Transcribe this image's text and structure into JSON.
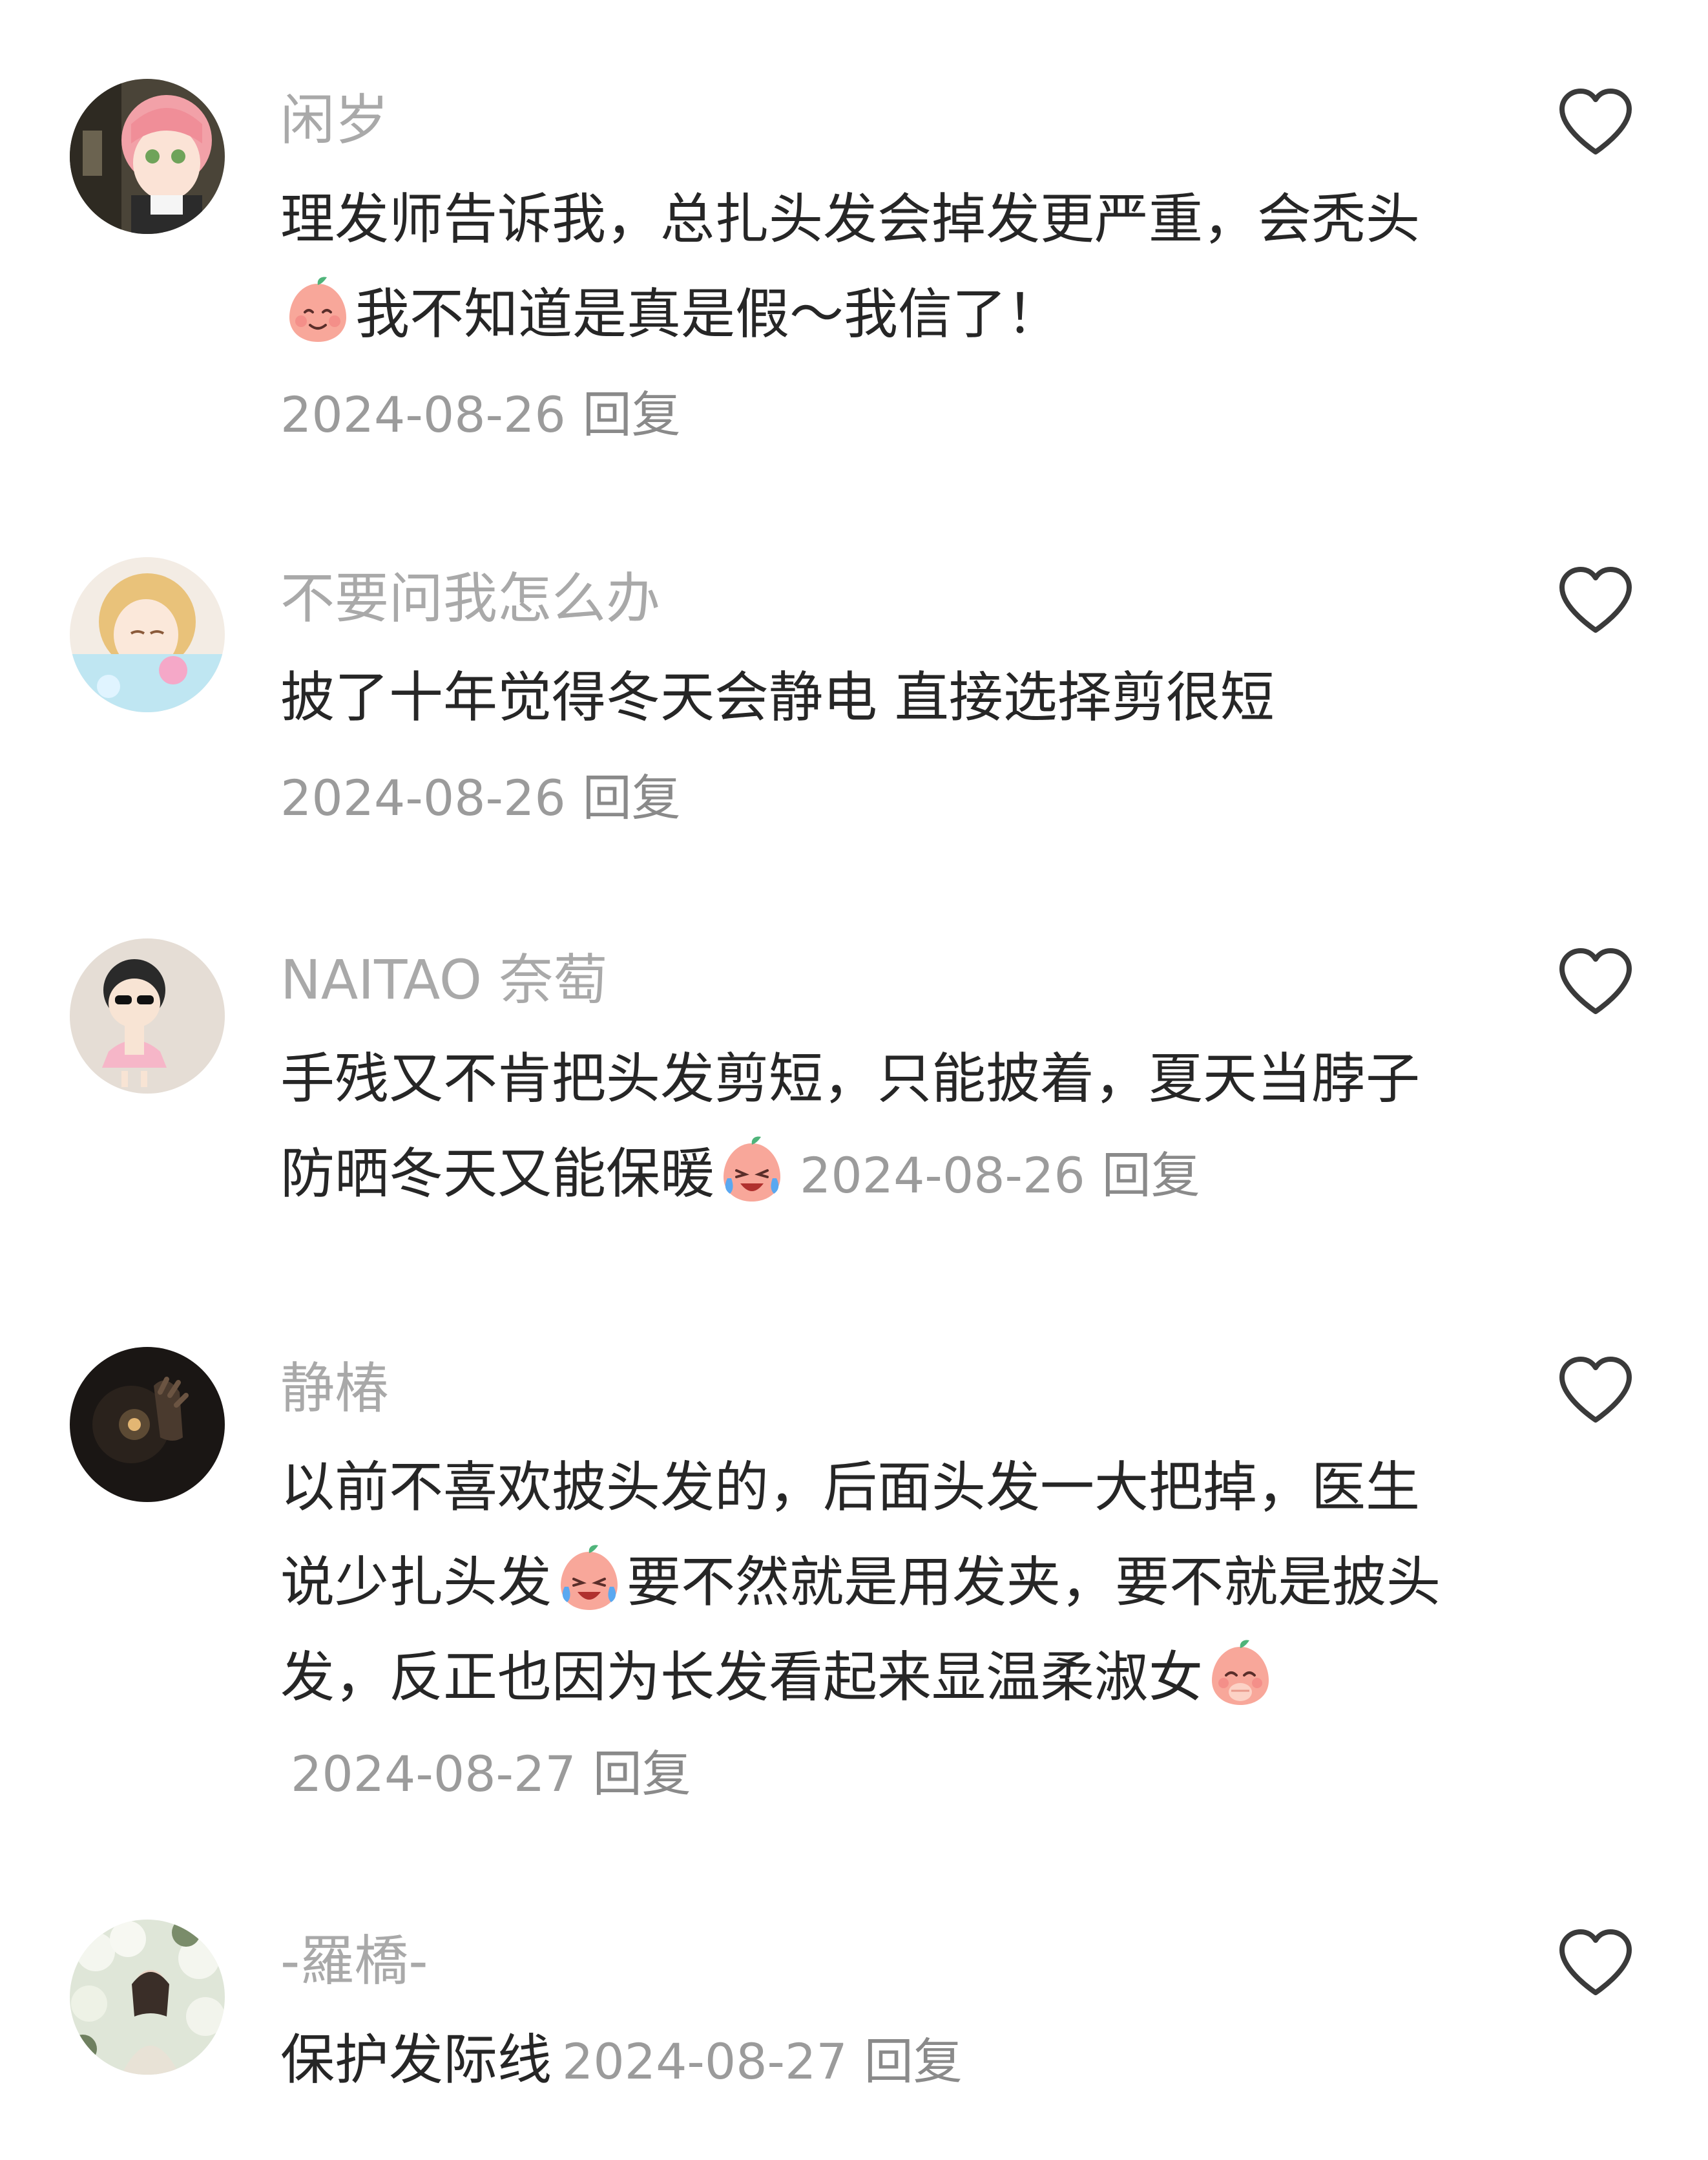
{
  "comments": [
    {
      "username": "闲岁",
      "text_parts": [
        "理发师告诉我，总扎头发会掉发更严重，会秃头",
        "我不知道是真是假～我信了！"
      ],
      "emoji": "smiling-peach-emoji",
      "date": "2024-08-26",
      "reply_label": "回复"
    },
    {
      "username": "不要问我怎么办",
      "text": "披了十年觉得冬天会静电 直接选择剪很短",
      "date": "2024-08-26",
      "reply_label": "回复"
    },
    {
      "username": "NAITAO 奈萄",
      "text": "手残又不肯把头发剪短，只能披着，夏天当脖子防晒冬天又能保暖",
      "emoji": "crying-laughing-peach-emoji",
      "date": "2024-08-26",
      "reply_label": "回复"
    },
    {
      "username": "静椿",
      "text_parts": [
        "以前不喜欢披头发的，后面头发一大把掉，医生说少扎头发",
        "要不然就是用发夹，要不就是披头发，反正也因为长发看起来显温柔淑女"
      ],
      "emojis": [
        "crying-laughing-peach-emoji",
        "giggling-peach-emoji"
      ],
      "date": "2024-08-27",
      "reply_label": "回复"
    },
    {
      "username": "-羅橋-",
      "text": "保护发际线",
      "date": "2024-08-27",
      "reply_label": "回复"
    }
  ],
  "icons": {
    "like": "heart-outline-icon"
  },
  "colors": {
    "username": "#a9a9a9",
    "text": "#262626",
    "meta": "#9b9b9b",
    "emoji_peach": "#f8a79a",
    "emoji_leaf": "#4fb47a"
  }
}
